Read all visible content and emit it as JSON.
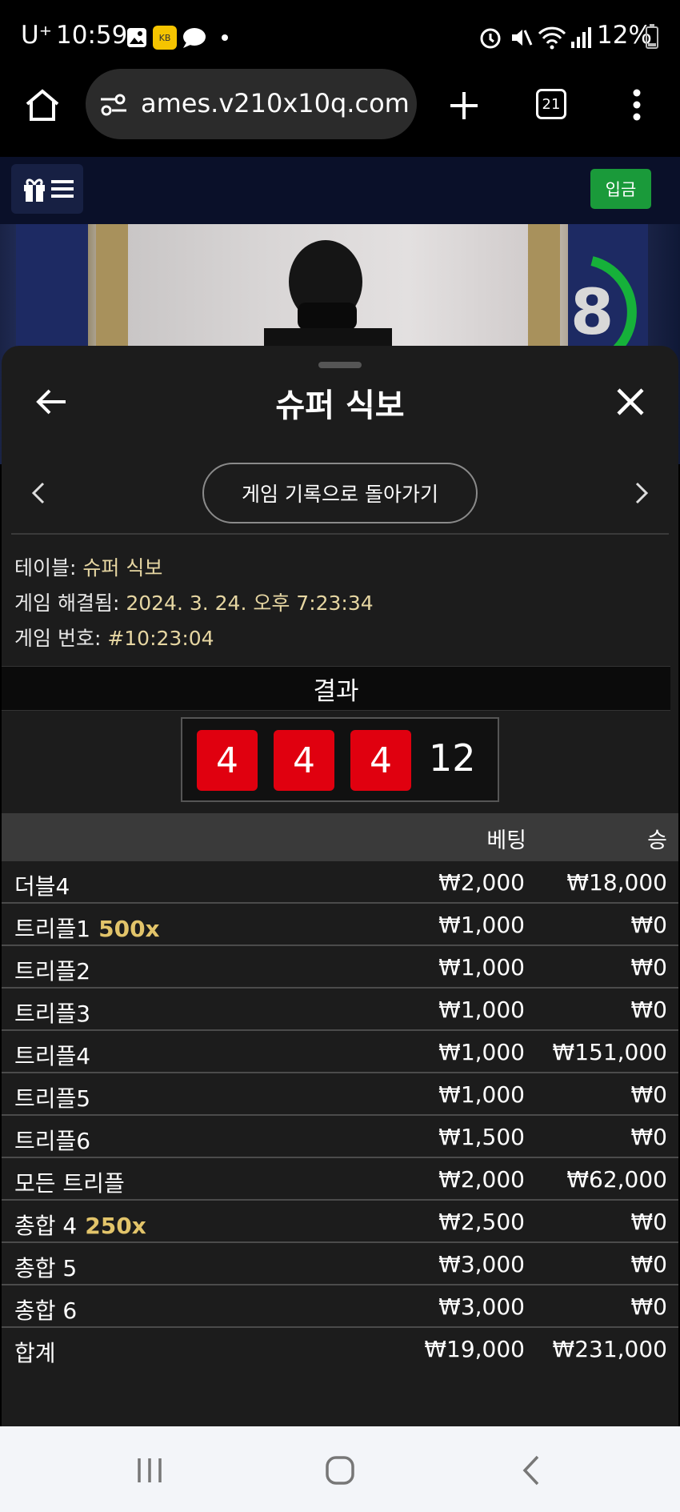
{
  "status_bar": {
    "carrier": "U⁺",
    "time": "10:59",
    "battery": "12%",
    "icons": [
      "gallery-icon",
      "kb-app-icon",
      "chat-icon",
      "dot-icon",
      "alarm-icon",
      "mute-icon",
      "wifi-icon",
      "signal-icon",
      "battery-icon"
    ]
  },
  "browser": {
    "url": "ames.v210x10q.com",
    "tab_count": "21",
    "icons": [
      "home-icon",
      "site-settings-icon",
      "new-tab-plus-icon",
      "tabs-icon",
      "more-vert-icon"
    ]
  },
  "site_header": {
    "menu_icons": [
      "gift-icon",
      "hamburger-icon"
    ],
    "deposit_label": "입금",
    "deposit_color": "#1a9a3a"
  },
  "video": {
    "timer_value": "8",
    "timer_color": "#16b13a"
  },
  "panel": {
    "title": "슈퍼 식보",
    "history_button": "게임 기록으로 돌아가기",
    "info": [
      {
        "label": "테이블: ",
        "value": "슈퍼 식보"
      },
      {
        "label": "게임 해결됨: ",
        "value": "2024. 3. 24. 오후 7:23:34"
      },
      {
        "label": "게임 번호: ",
        "value": "#10:23:04"
      }
    ],
    "result_heading": "결과",
    "dice": [
      "4",
      "4",
      "4"
    ],
    "dice_color": "#e0000f",
    "dice_total": "12",
    "table": {
      "columns": {
        "bet": "베팅",
        "win": "승"
      },
      "rows": [
        {
          "name": "더블4",
          "multiplier": "",
          "bet": "₩2,000",
          "win": "₩18,000"
        },
        {
          "name": "트리플1",
          "multiplier": "500x",
          "bet": "₩1,000",
          "win": "₩0"
        },
        {
          "name": "트리플2",
          "multiplier": "",
          "bet": "₩1,000",
          "win": "₩0"
        },
        {
          "name": "트리플3",
          "multiplier": "",
          "bet": "₩1,000",
          "win": "₩0"
        },
        {
          "name": "트리플4",
          "multiplier": "",
          "bet": "₩1,000",
          "win": "₩151,000"
        },
        {
          "name": "트리플5",
          "multiplier": "",
          "bet": "₩1,000",
          "win": "₩0"
        },
        {
          "name": "트리플6",
          "multiplier": "",
          "bet": "₩1,500",
          "win": "₩0"
        },
        {
          "name": "모든 트리플",
          "multiplier": "",
          "bet": "₩2,000",
          "win": "₩62,000"
        },
        {
          "name": "총합 4",
          "multiplier": "250x",
          "bet": "₩2,500",
          "win": "₩0"
        },
        {
          "name": "총합 5",
          "multiplier": "",
          "bet": "₩3,000",
          "win": "₩0"
        },
        {
          "name": "총합 6",
          "multiplier": "",
          "bet": "₩3,000",
          "win": "₩0"
        }
      ],
      "total": {
        "name": "합계",
        "bet": "₩19,000",
        "win": "₩231,000"
      }
    }
  },
  "nav_bar": {
    "icons": [
      "recent-apps-icon",
      "home-circle-icon",
      "back-chevron-icon"
    ]
  }
}
